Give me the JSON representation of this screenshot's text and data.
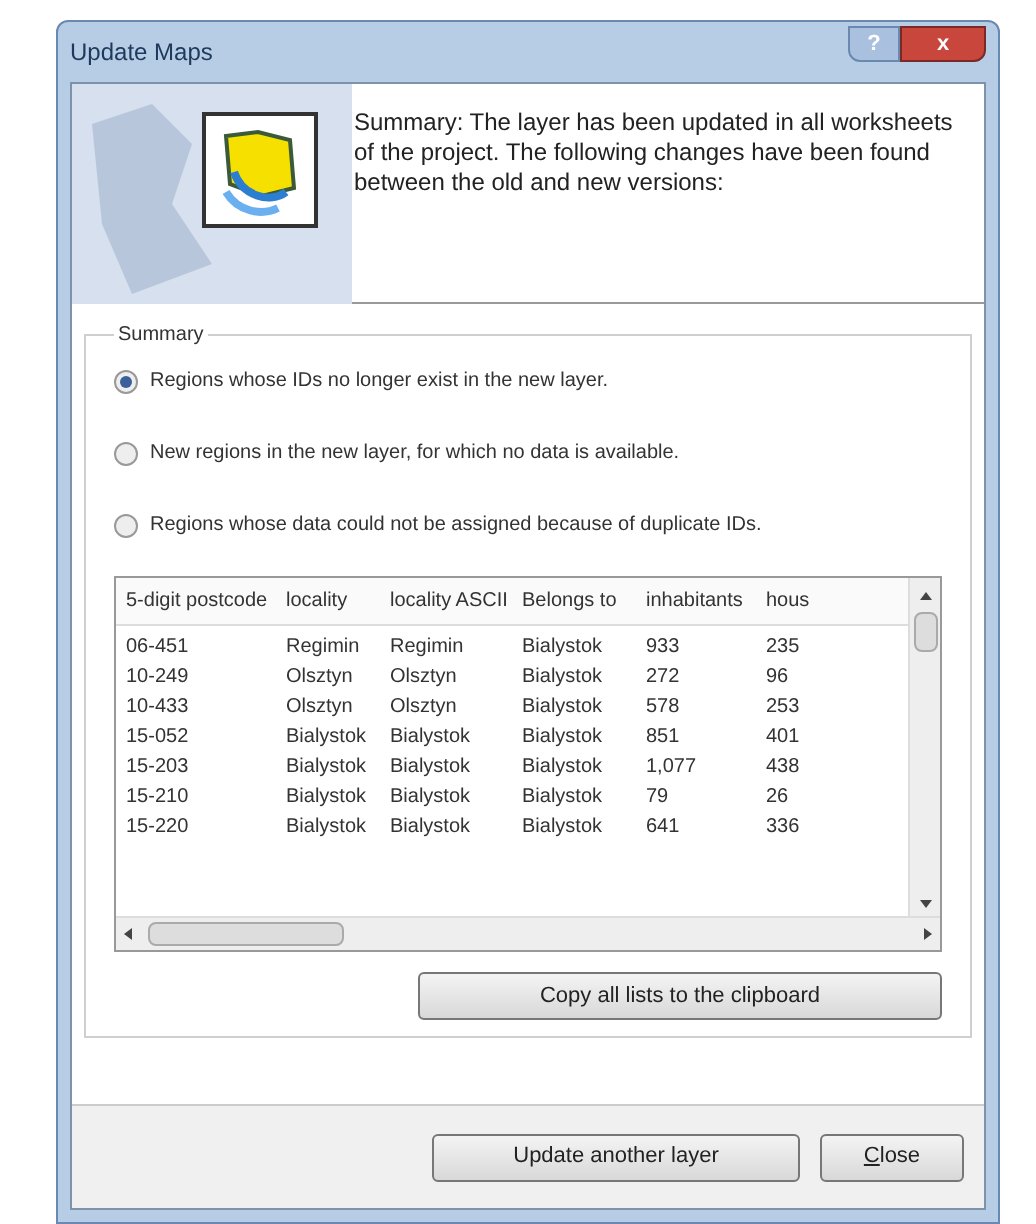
{
  "window": {
    "title": "Update Maps",
    "controls": [
      "?",
      "x"
    ]
  },
  "header": {
    "message": "Summary: The layer has been updated in all worksheets of the project. The following changes have been found between the old and new versions:"
  },
  "summary": {
    "title": "Summary",
    "options": [
      {
        "label": "Regions whose IDs no longer exist in the new layer.",
        "selected": true
      },
      {
        "label": "New regions in the new layer, for which no data is available.",
        "selected": false
      },
      {
        "label": "Regions whose data could not be assigned because of duplicate IDs.",
        "selected": false
      }
    ]
  },
  "table": {
    "columns": [
      "5-digit postcode",
      "locality",
      "locality ASCII",
      "Belongs to",
      "inhabitants",
      "hous"
    ],
    "rows": [
      [
        "06-451",
        "Regimin",
        "Regimin",
        "Bialystok",
        "933",
        "235"
      ],
      [
        "10-249",
        "Olsztyn",
        "Olsztyn",
        "Bialystok",
        "272",
        "96"
      ],
      [
        "10-433",
        "Olsztyn",
        "Olsztyn",
        "Bialystok",
        "578",
        "253"
      ],
      [
        "15-052",
        "Bialystok",
        "Bialystok",
        "Bialystok",
        "851",
        "401"
      ],
      [
        "15-203",
        "Bialystok",
        "Bialystok",
        "Bialystok",
        "1,077",
        "438"
      ],
      [
        "15-210",
        "Bialystok",
        "Bialystok",
        "Bialystok",
        "79",
        "26"
      ],
      [
        "15-220",
        "Bialystok",
        "Bialystok",
        "Bialystok",
        "641",
        "336"
      ]
    ]
  },
  "copy_button": "Copy all lists to the clipboard",
  "buttons": [
    {
      "label": "Update another layer"
    },
    {
      "label": "**C**lose"
    }
  ]
}
